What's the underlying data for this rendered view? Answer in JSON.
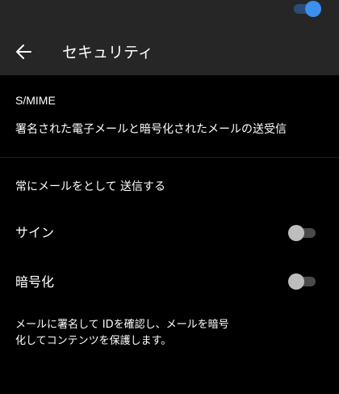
{
  "header": {
    "title": "セキュリティ",
    "back_icon": "arrow-left-icon"
  },
  "smime": {
    "label": "S/MIME",
    "description": "署名された電子メールと暗号化されたメールの送受信",
    "enabled": true
  },
  "always_send": {
    "label": "常にメールをとして 送信する"
  },
  "sign": {
    "label": "サイン",
    "enabled": false
  },
  "encrypt": {
    "label": "暗号化",
    "enabled": false
  },
  "footnote": "メールに署名して IDを確認し、メールを暗号化してコンテンツを保護します。",
  "colors": {
    "header_bg": "#262626",
    "background": "#000000",
    "accent": "#3d8ff0",
    "toggle_off_thumb": "#bdbdbd"
  }
}
